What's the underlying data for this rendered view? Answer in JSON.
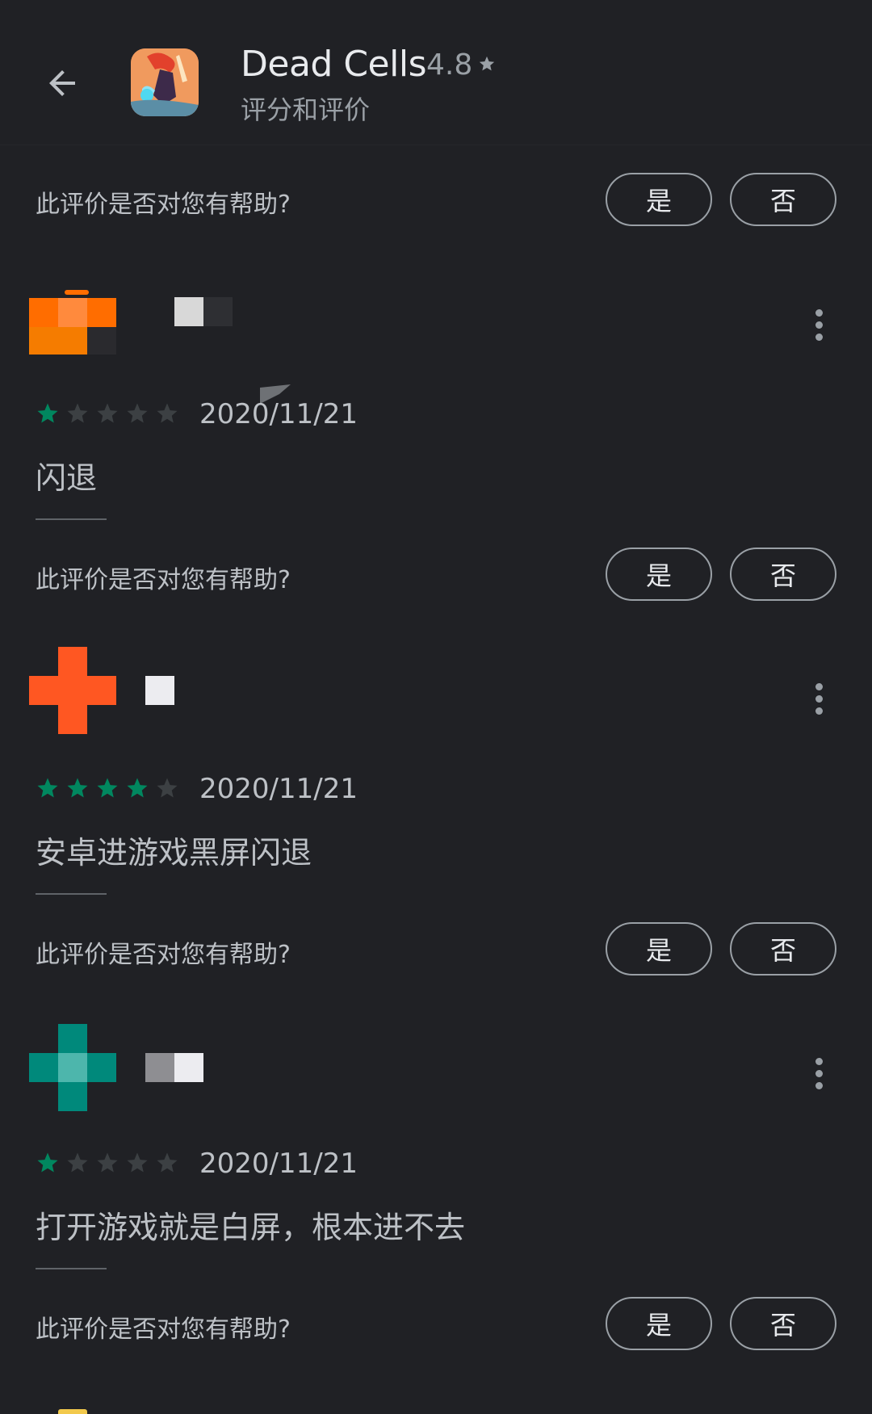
{
  "header": {
    "app_name": "Dead Cells",
    "rating": "4.8",
    "subtitle": "评分和评价"
  },
  "helpful": {
    "question": "此评价是否对您有帮助?",
    "yes": "是",
    "no": "否"
  },
  "reviews": [
    {
      "stars": 1,
      "date": "2020/11/21",
      "text": "闪退",
      "avatar_colors": [
        "#ff7a1a",
        "#ff6a00"
      ]
    },
    {
      "stars": 4,
      "date": "2020/11/21",
      "text": "安卓进游戏黑屏闪退",
      "avatar_colors": [
        "#ff5722",
        "#ff5722"
      ]
    },
    {
      "stars": 1,
      "date": "2020/11/21",
      "text": "打开游戏就是白屏，根本进不去",
      "avatar_colors": [
        "#00897b",
        "#4db6ac"
      ]
    }
  ],
  "colors": {
    "background": "#202125",
    "star_filled": "#01875f",
    "star_empty": "#3c4043",
    "text_primary": "#e8eaed",
    "text_secondary": "#9aa0a6"
  }
}
